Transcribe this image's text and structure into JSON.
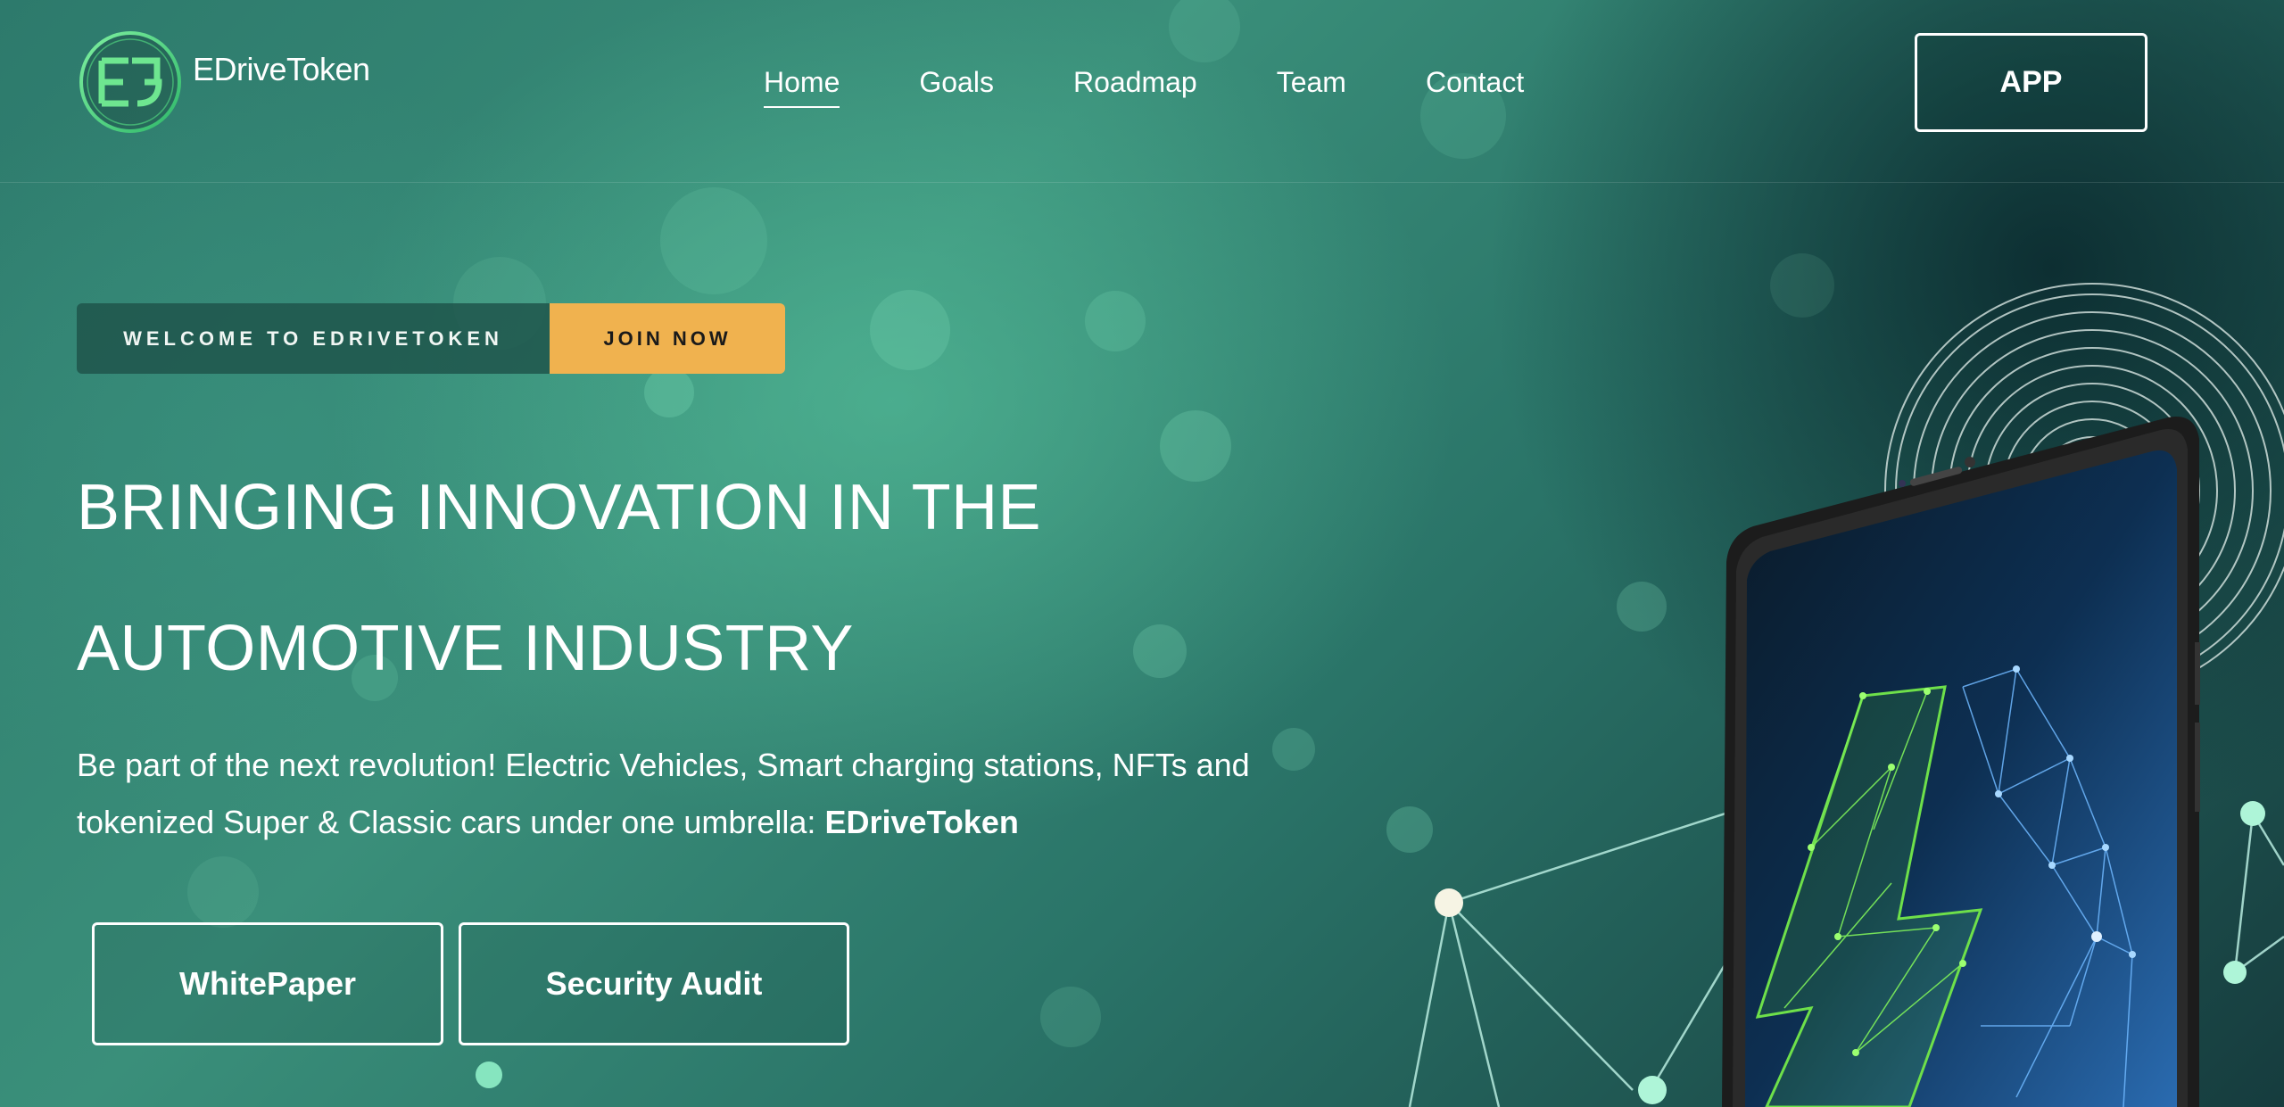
{
  "brand": {
    "name": "EDriveToken",
    "colors": {
      "accent": "#f0b24f",
      "logo_green": "#5ad36a",
      "bg_teal": "#2d7a6c"
    }
  },
  "nav": {
    "items": [
      {
        "label": "Home",
        "active": true
      },
      {
        "label": "Goals",
        "active": false
      },
      {
        "label": "Roadmap",
        "active": false
      },
      {
        "label": "Team",
        "active": false
      },
      {
        "label": "Contact",
        "active": false
      }
    ],
    "app_button": "APP"
  },
  "hero": {
    "welcome_label": "WELCOME TO EDRIVETOKEN",
    "join_label": "JOIN NOW",
    "headline_line1": "BRINGING INNOVATION IN THE",
    "headline_line2": "AUTOMOTIVE INDUSTRY",
    "subtext": "Be part of the next revolution! Electric Vehicles, Smart charging stations, NFTs and tokenized Super & Classic cars under one umbrella:",
    "subtext_brand": "EDriveToken",
    "buttons": {
      "whitepaper": "WhitePaper",
      "audit": "Security Audit"
    }
  },
  "icons": [
    "edrivetoken-logo-icon",
    "phone-illustration",
    "lightning-bolt-icon",
    "signal-rings-icon"
  ]
}
